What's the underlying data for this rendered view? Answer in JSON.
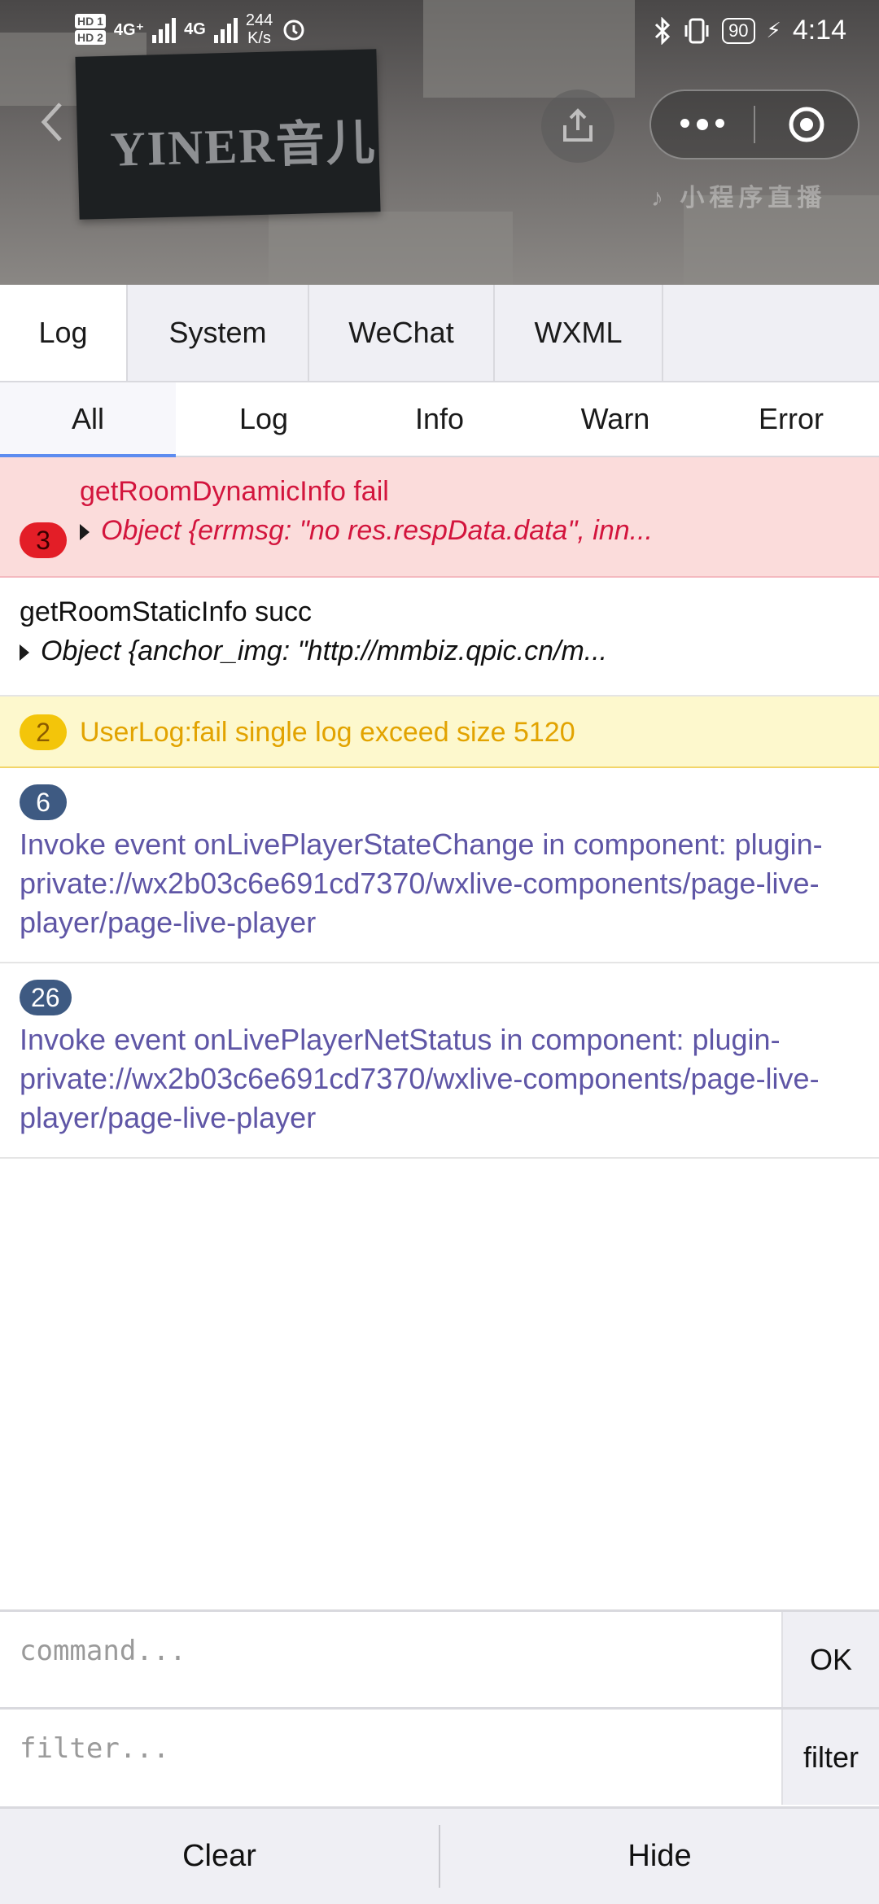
{
  "status_bar": {
    "hd1": "HD 1",
    "hd2": "HD 2",
    "net1": "4G⁺",
    "net2": "4G",
    "speed_value": "244",
    "speed_unit": "K/s",
    "battery": "90",
    "time": "4:14"
  },
  "header": {
    "sign_text": "YINER音儿",
    "live_mark": "小程序直播"
  },
  "panel_tabs": [
    {
      "label": "Log",
      "active": true
    },
    {
      "label": "System",
      "active": false
    },
    {
      "label": "WeChat",
      "active": false
    },
    {
      "label": "WXML",
      "active": false
    }
  ],
  "level_tabs": [
    {
      "label": "All",
      "active": true
    },
    {
      "label": "Log",
      "active": false
    },
    {
      "label": "Info",
      "active": false
    },
    {
      "label": "Warn",
      "active": false
    },
    {
      "label": "Error",
      "active": false
    }
  ],
  "logs": [
    {
      "type": "error",
      "count": "3",
      "title": "getRoomDynamicInfo fail",
      "object": "Object {errmsg: \"no res.respData.data\", inn..."
    },
    {
      "type": "log",
      "title": "getRoomStaticInfo succ",
      "object": "Object {anchor_img: \"http://mmbiz.qpic.cn/m..."
    },
    {
      "type": "warn",
      "count": "2",
      "title": "UserLog:fail single log exceed size 5120"
    },
    {
      "type": "info",
      "count": "6",
      "message": "Invoke event onLivePlayerStateChange in component: plugin-private://wx2b03c6e691cd7370/wxlive-components/page-live-player/page-live-player"
    },
    {
      "type": "info",
      "count": "26",
      "message": "Invoke event onLivePlayerNetStatus in component: plugin-private://wx2b03c6e691cd7370/wxlive-components/page-live-player/page-live-player"
    }
  ],
  "command": {
    "placeholder": "command...",
    "button": "OK"
  },
  "filter": {
    "placeholder": "filter...",
    "button": "filter"
  },
  "bottom_buttons": {
    "clear": "Clear",
    "hide": "Hide"
  },
  "colors": {
    "error_bg": "#fbdcdb",
    "error_text": "#d3153d",
    "warn_bg": "#fdf8cd",
    "warn_text": "#e2a300",
    "info_text": "#5f56a6",
    "active_tab_underline": "#5d8cf0"
  }
}
